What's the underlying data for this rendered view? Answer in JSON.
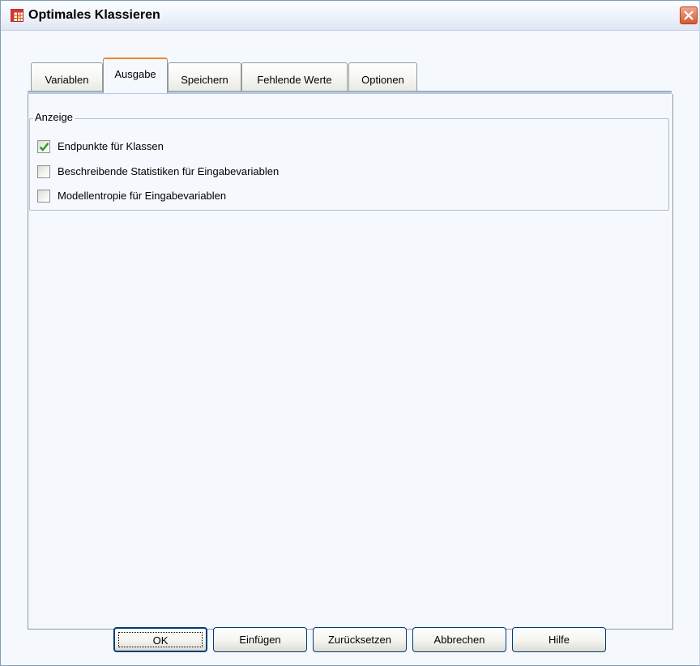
{
  "window": {
    "title": "Optimales Klassieren"
  },
  "tabs": [
    {
      "label": "Variablen",
      "active": false
    },
    {
      "label": "Ausgabe",
      "active": true
    },
    {
      "label": "Speichern",
      "active": false
    },
    {
      "label": "Fehlende Werte",
      "active": false
    },
    {
      "label": "Optionen",
      "active": false
    }
  ],
  "display_group": {
    "legend": "Anzeige",
    "options": [
      {
        "label": "Endpunkte für Klassen",
        "checked": true
      },
      {
        "label": "Beschreibende Statistiken für Eingabevariablen",
        "checked": false
      },
      {
        "label": "Modellentropie für Eingabevariablen",
        "checked": false
      }
    ]
  },
  "buttons": {
    "ok": "OK",
    "paste": "Einfügen",
    "reset": "Zurücksetzen",
    "cancel": "Abbrechen",
    "help": "Hilfe"
  },
  "icons": {
    "app": "spss-data-table-icon",
    "close": "close-icon",
    "check": "checkmark-icon"
  },
  "colors": {
    "active_tab_accent": "#e68b2c",
    "dialog_background": "#f5f8fd",
    "close_button": "#d45a36"
  }
}
